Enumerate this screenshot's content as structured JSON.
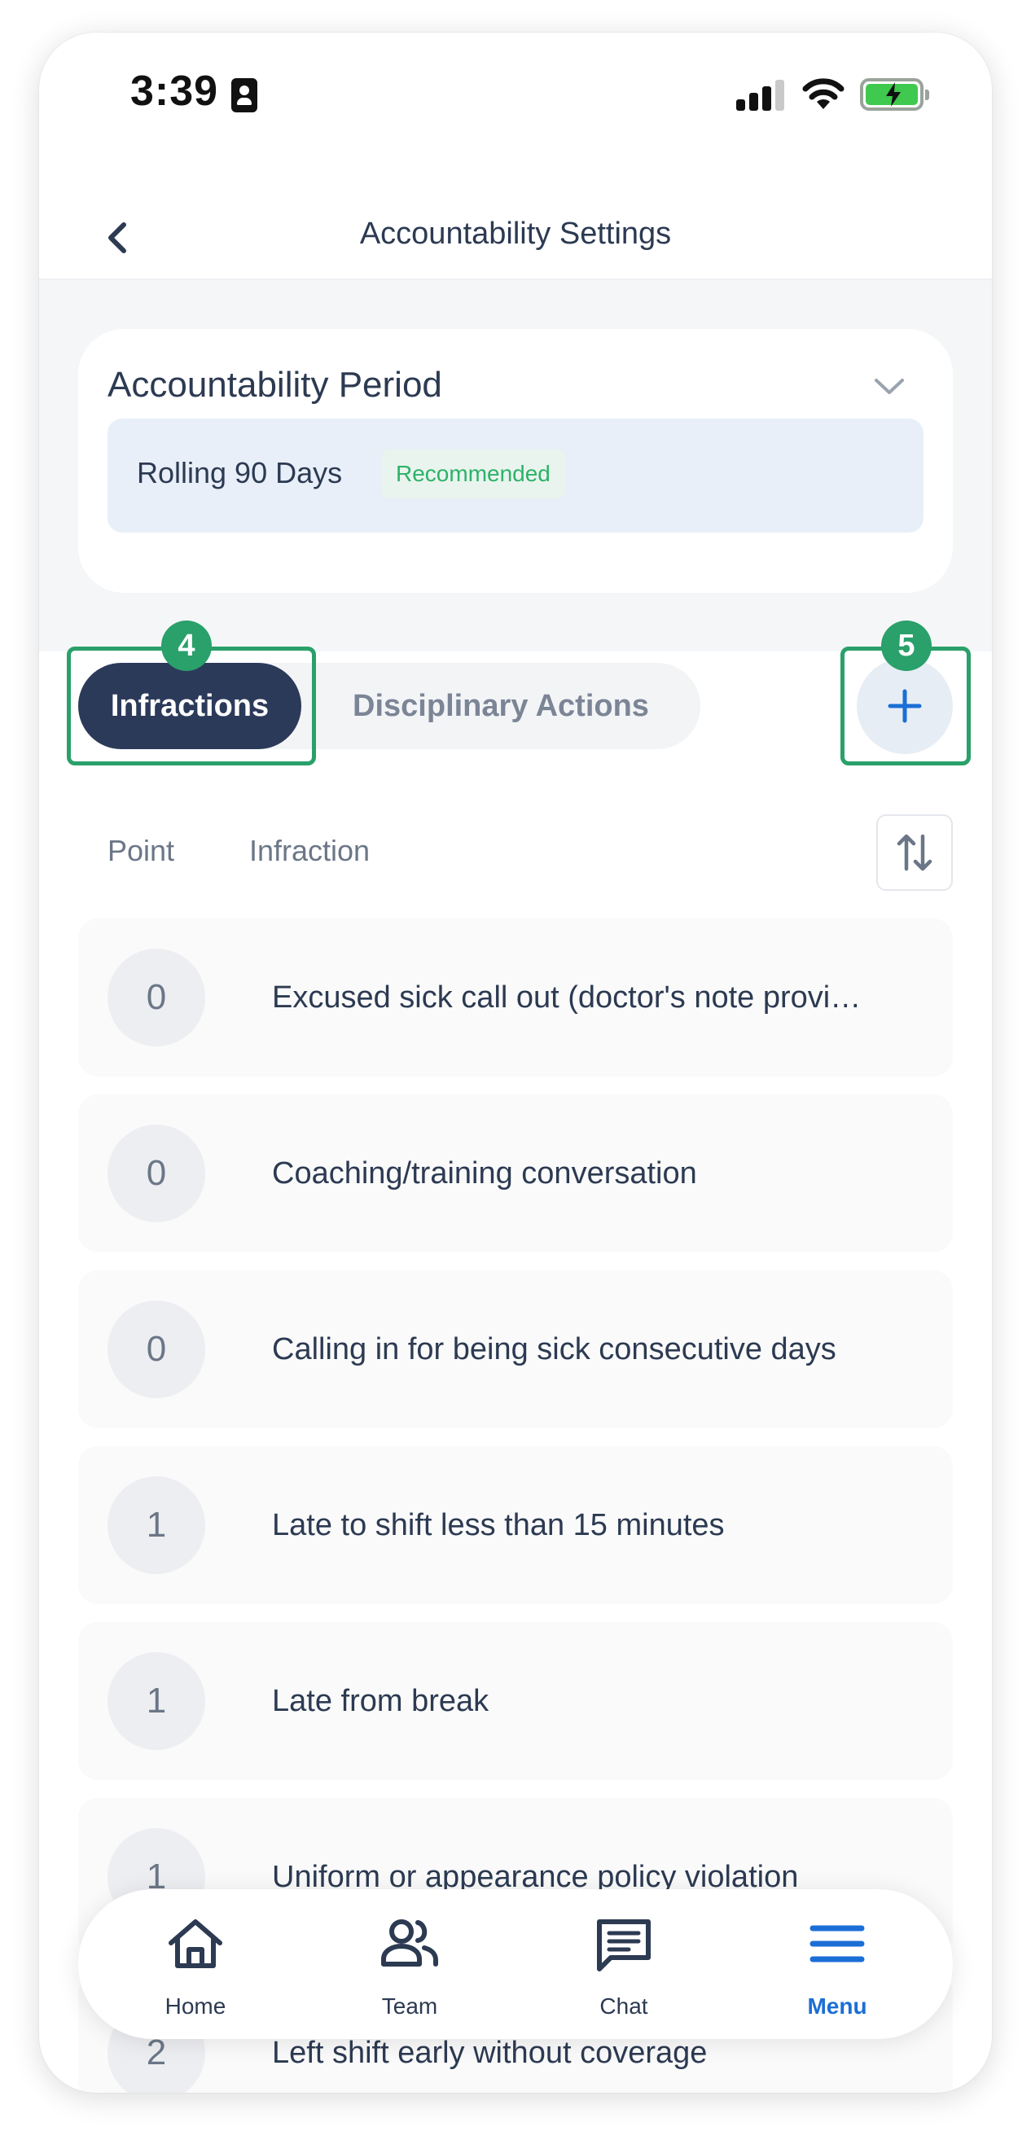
{
  "status_bar": {
    "time": "3:39",
    "icons": [
      "id-card-icon",
      "signal-icon",
      "wifi-icon",
      "battery-charging-icon"
    ]
  },
  "header": {
    "title": "Accountability Settings",
    "back_icon": "chevron-left-icon"
  },
  "period": {
    "label": "Accountability Period",
    "value": "Rolling 90 Days",
    "badge": "Recommended"
  },
  "tabs": [
    {
      "label": "Infractions",
      "active": true
    },
    {
      "label": "Disciplinary Actions",
      "active": false
    }
  ],
  "callouts": {
    "tabs": "4",
    "add": "5"
  },
  "list": {
    "columns": {
      "point": "Point",
      "infraction": "Infraction"
    },
    "rows": [
      {
        "point": "0",
        "infraction": "Excused sick call out (doctor's note provi…"
      },
      {
        "point": "0",
        "infraction": "Coaching/training conversation"
      },
      {
        "point": "0",
        "infraction": "Calling in for being sick consecutive days"
      },
      {
        "point": "1",
        "infraction": "Late to shift less than 15 minutes"
      },
      {
        "point": "1",
        "infraction": "Late from break"
      },
      {
        "point": "1",
        "infraction": "Uniform or appearance policy violation"
      },
      {
        "point": "2",
        "infraction": "Left shift early without coverage"
      }
    ]
  },
  "bottom_nav": {
    "items": [
      {
        "label": "Home",
        "icon": "home-icon"
      },
      {
        "label": "Team",
        "icon": "team-icon"
      },
      {
        "label": "Chat",
        "icon": "chat-icon"
      },
      {
        "label": "Menu",
        "icon": "menu-icon",
        "active": true
      }
    ]
  },
  "colors": {
    "accent": "#1b6ed6",
    "tab_active": "#2c3a5a",
    "badge_green": "#2db269",
    "callout_green": "#2aa06a"
  }
}
